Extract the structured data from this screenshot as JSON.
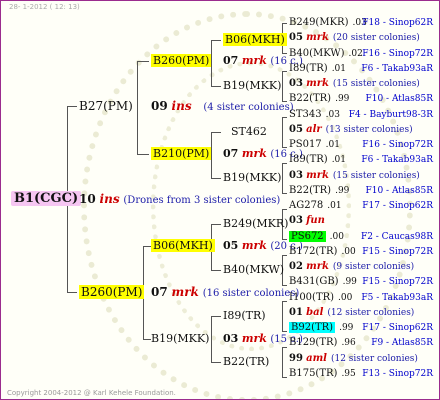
{
  "header": {
    "date": "28-  1-2012 ( 12: 13)"
  },
  "root": {
    "name": "B1(CGC)",
    "year": "10",
    "breeder": "ins",
    "note": "(Drones from 3 sister colonies)"
  },
  "g1": {
    "sire": "B27(PM)",
    "sire_year": "09",
    "sire_breeder": "ins",
    "sire_note": "(4 sister colonies)",
    "dam": "B260(PM)",
    "dam_year": "07",
    "dam_breeder": "mrk",
    "dam_note": "(16 sister colonies)"
  },
  "g2": [
    {
      "name": "B260(PM)",
      "year": "07",
      "breeder": "mrk",
      "note": "(16 c.)"
    },
    {
      "name": "B210(PM)",
      "year": "07",
      "breeder": "mrk",
      "note": "(16 c.)"
    },
    {
      "name": "B06(MKH)",
      "year": "05",
      "breeder": "mrk",
      "note": "(20 c.)"
    },
    {
      "name": "B19(MKK)",
      "year": "03",
      "breeder": "mrk",
      "note": "(15 c.)"
    }
  ],
  "g3": [
    "B06(MKH)",
    "B19(MKK)",
    "ST462",
    "B19(MKK)",
    "B249(MKR)",
    "B40(MKW)",
    "I89(TR)",
    "B22(TR)"
  ],
  "g4": [
    {
      "name": "B249(MKR)",
      "year": ".03",
      "colony": "F18 - Sinop62R"
    },
    {
      "name": "05",
      "breeder": "mrk",
      "note": "(20 sister colonies)"
    },
    {
      "name": "B40(MKW)",
      "year": ".02",
      "colony": "F16 - Sinop72R"
    },
    {
      "name": "I89(TR)",
      "year": ".01",
      "colony": "F6 - Takab93aR"
    },
    {
      "name": "03",
      "breeder": "mrk",
      "note": "(15 sister colonies)"
    },
    {
      "name": "B22(TR)",
      "year": ".99",
      "colony": "F10 - Atlas85R"
    },
    {
      "name": "ST343",
      "year": ".03",
      "colony": "F4 - Bayburt98-3R"
    },
    {
      "name": "05",
      "breeder": "alr",
      "note": "(13 sister colonies)"
    },
    {
      "name": "PS017",
      "year": ".01",
      "colony": "F16 - Sinop72R"
    },
    {
      "name": "I89(TR)",
      "year": ".01",
      "colony": "F6 - Takab93aR"
    },
    {
      "name": "03",
      "breeder": "mrk",
      "note": "(15 sister colonies)"
    },
    {
      "name": "B22(TR)",
      "year": ".99",
      "colony": "F10 - Atlas85R"
    },
    {
      "name": "AG278",
      "year": ".01",
      "colony": "F17 - Sinop62R"
    },
    {
      "name": "03",
      "breeder": "fun",
      "note": ""
    },
    {
      "name": "PS672",
      "year": ".00",
      "colony": "F2 - Caucas98R",
      "hl": "g"
    },
    {
      "name": "B172(TR)",
      "year": ".00",
      "colony": "F15 - Sinop72R"
    },
    {
      "name": "02",
      "breeder": "mrk",
      "note": "(9 sister colonies)"
    },
    {
      "name": "B431(GB)",
      "year": ".99",
      "colony": "F15 - Sinop72R"
    },
    {
      "name": "I100(TR)",
      "year": ".00",
      "colony": "F5 - Takab93aR"
    },
    {
      "name": "01",
      "breeder": "bal",
      "note": "(12 sister colonies)"
    },
    {
      "name": "B92(TR)",
      "year": ".99",
      "colony": "F17 - Sinop62R",
      "hl": "c"
    },
    {
      "name": "B129(TR)",
      "year": ".96",
      "colony": "F9 - Atlas85R"
    },
    {
      "name": "99",
      "breeder": "aml",
      "note": "(12 sister colonies)"
    },
    {
      "name": "B175(TR)",
      "year": ".95",
      "colony": "F13 - Sinop72R"
    }
  ],
  "footer": {
    "copyright": "Copyright 2004-2012 @ Karl Kehele Foundation."
  }
}
